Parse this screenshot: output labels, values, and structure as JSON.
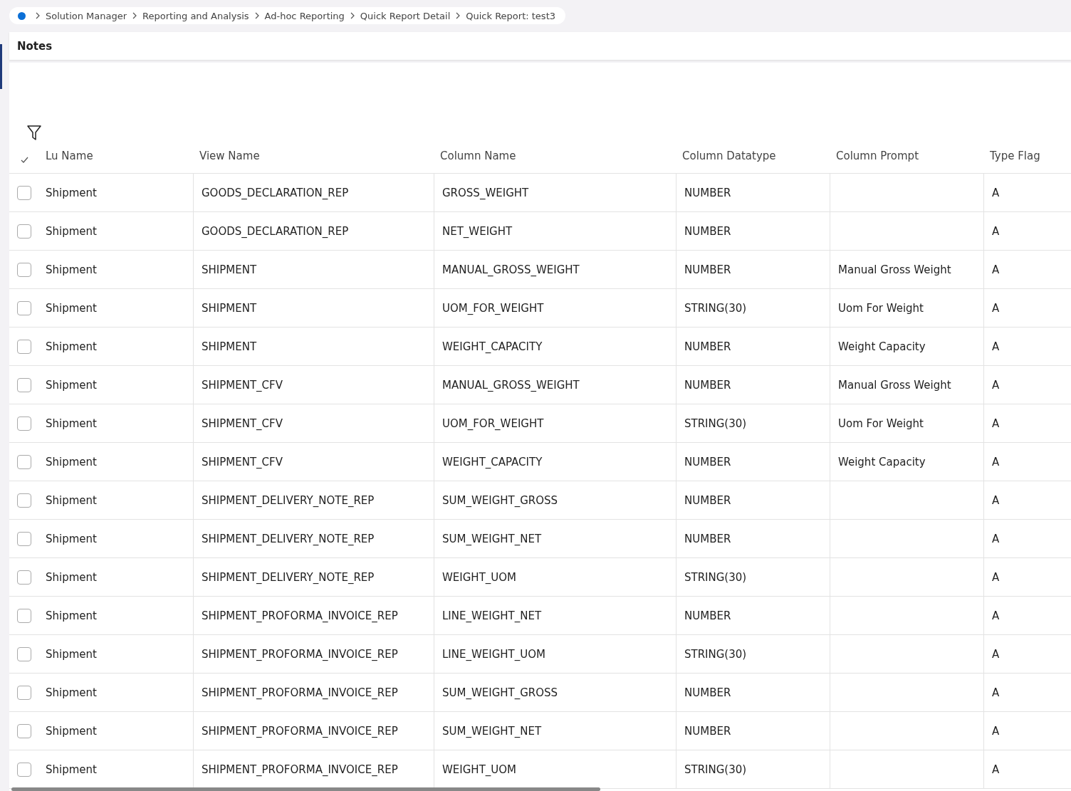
{
  "breadcrumb": [
    "Solution Manager",
    "Reporting and Analysis",
    "Ad-hoc Reporting",
    "Quick Report Detail",
    "Quick Report: test3"
  ],
  "panel_title": "Notes",
  "table": {
    "columns": [
      "Lu Name",
      "View Name",
      "Column Name",
      "Column Datatype",
      "Column Prompt",
      "Type Flag"
    ],
    "rows": [
      {
        "checked": false,
        "cells": [
          "Shipment",
          "GOODS_DECLARATION_REP",
          "GROSS_WEIGHT",
          "NUMBER",
          "",
          "A"
        ]
      },
      {
        "checked": false,
        "cells": [
          "Shipment",
          "GOODS_DECLARATION_REP",
          "NET_WEIGHT",
          "NUMBER",
          "",
          "A"
        ]
      },
      {
        "checked": false,
        "cells": [
          "Shipment",
          "SHIPMENT",
          "MANUAL_GROSS_WEIGHT",
          "NUMBER",
          "Manual Gross Weight",
          "A"
        ]
      },
      {
        "checked": false,
        "cells": [
          "Shipment",
          "SHIPMENT",
          "UOM_FOR_WEIGHT",
          "STRING(30)",
          "Uom For Weight",
          "A"
        ]
      },
      {
        "checked": false,
        "cells": [
          "Shipment",
          "SHIPMENT",
          "WEIGHT_CAPACITY",
          "NUMBER",
          "Weight Capacity",
          "A"
        ]
      },
      {
        "checked": false,
        "cells": [
          "Shipment",
          "SHIPMENT_CFV",
          "MANUAL_GROSS_WEIGHT",
          "NUMBER",
          "Manual Gross Weight",
          "A"
        ]
      },
      {
        "checked": false,
        "cells": [
          "Shipment",
          "SHIPMENT_CFV",
          "UOM_FOR_WEIGHT",
          "STRING(30)",
          "Uom For Weight",
          "A"
        ]
      },
      {
        "checked": false,
        "cells": [
          "Shipment",
          "SHIPMENT_CFV",
          "WEIGHT_CAPACITY",
          "NUMBER",
          "Weight Capacity",
          "A"
        ]
      },
      {
        "checked": false,
        "cells": [
          "Shipment",
          "SHIPMENT_DELIVERY_NOTE_REP",
          "SUM_WEIGHT_GROSS",
          "NUMBER",
          "",
          "A"
        ]
      },
      {
        "checked": false,
        "cells": [
          "Shipment",
          "SHIPMENT_DELIVERY_NOTE_REP",
          "SUM_WEIGHT_NET",
          "NUMBER",
          "",
          "A"
        ]
      },
      {
        "checked": false,
        "cells": [
          "Shipment",
          "SHIPMENT_DELIVERY_NOTE_REP",
          "WEIGHT_UOM",
          "STRING(30)",
          "",
          "A"
        ]
      },
      {
        "checked": false,
        "cells": [
          "Shipment",
          "SHIPMENT_PROFORMA_INVOICE_REP",
          "LINE_WEIGHT_NET",
          "NUMBER",
          "",
          "A"
        ]
      },
      {
        "checked": false,
        "cells": [
          "Shipment",
          "SHIPMENT_PROFORMA_INVOICE_REP",
          "LINE_WEIGHT_UOM",
          "STRING(30)",
          "",
          "A"
        ]
      },
      {
        "checked": false,
        "cells": [
          "Shipment",
          "SHIPMENT_PROFORMA_INVOICE_REP",
          "SUM_WEIGHT_GROSS",
          "NUMBER",
          "",
          "A"
        ]
      },
      {
        "checked": false,
        "cells": [
          "Shipment",
          "SHIPMENT_PROFORMA_INVOICE_REP",
          "SUM_WEIGHT_NET",
          "NUMBER",
          "",
          "A"
        ]
      },
      {
        "checked": false,
        "cells": [
          "Shipment",
          "SHIPMENT_PROFORMA_INVOICE_REP",
          "WEIGHT_UOM",
          "STRING(30)",
          "",
          "A"
        ]
      }
    ]
  }
}
